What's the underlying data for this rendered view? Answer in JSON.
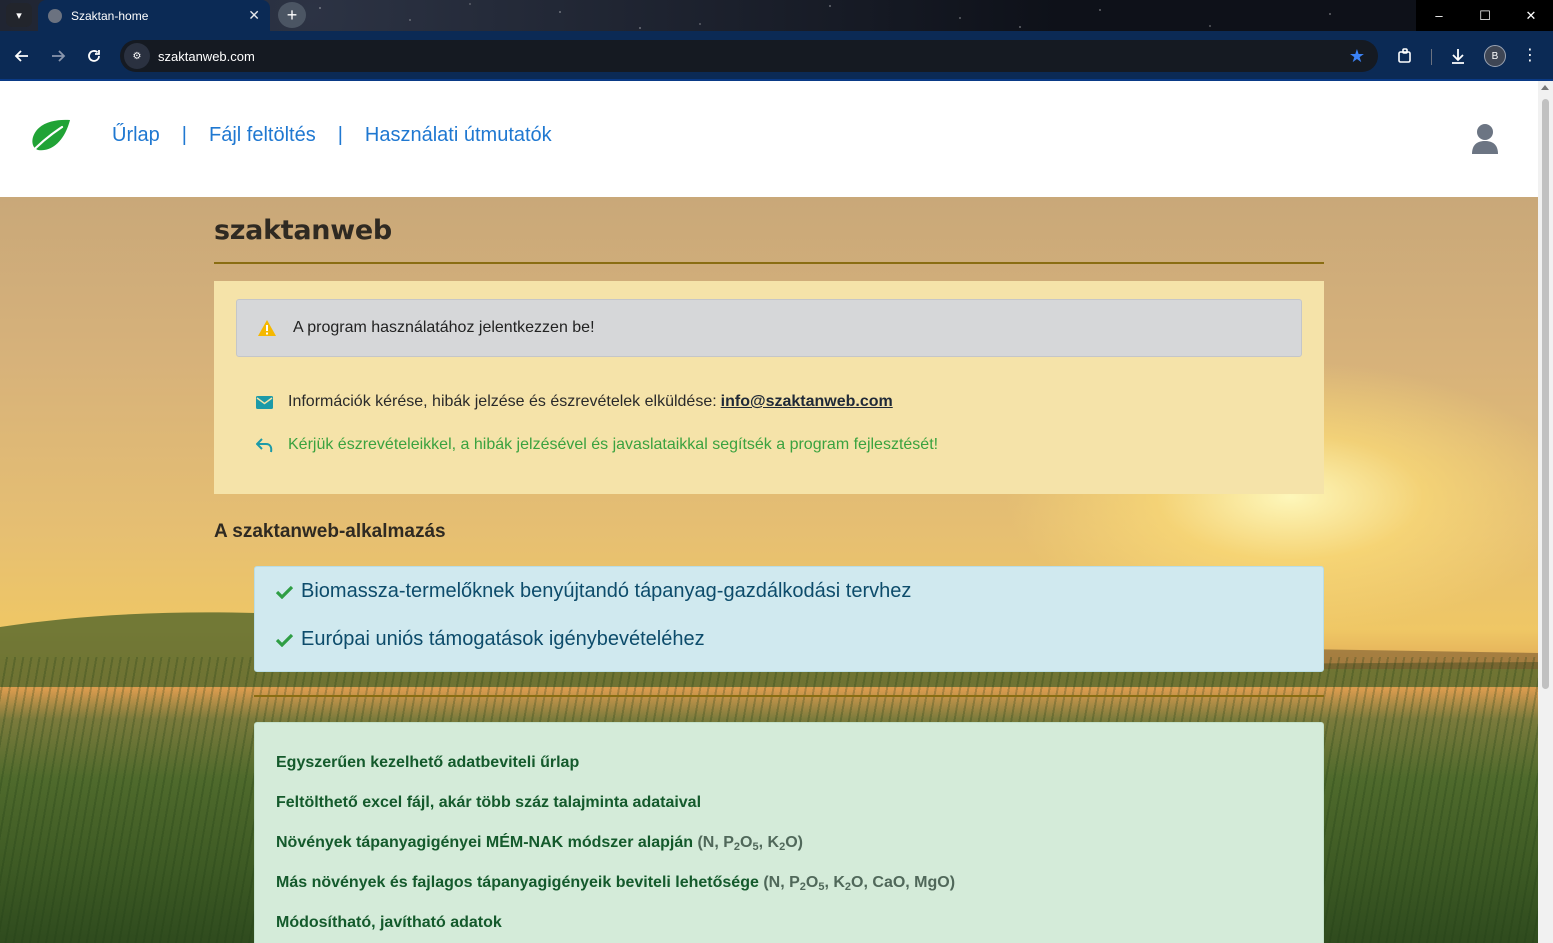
{
  "browser": {
    "tab_title": "Szaktan-home",
    "url": "szaktanweb.com",
    "profile_initial": "B",
    "tab_menu_icon": "chevron-down-icon",
    "new_tab_label": "+",
    "window_controls": {
      "minimize": "–",
      "maximize": "☐",
      "close": "✕"
    }
  },
  "header": {
    "nav": [
      {
        "label": "Űrlap"
      },
      {
        "label": "Fájl feltöltés"
      },
      {
        "label": "Használati útmutatók"
      }
    ],
    "separator": "|"
  },
  "main": {
    "title": "szaktanweb",
    "alert_text": "A program használatához jelentkezzen be!",
    "info_text": "Információk kérése, hibák jelzése és észrevételek elküldése:",
    "info_email": "info@szaktanweb.com",
    "feedback_text": "Kérjük észrevételeikkel, a hibák jelzésével és javaslataikkal segítsék a program fejlesztését!",
    "section_heading": "A szaktanweb-alkalmazás",
    "purposes": [
      "Biomassza-termelőknek benyújtandó tápanyag-gazdálkodási tervhez",
      "Európai uniós támogatások igénybevételéhez"
    ],
    "features": [
      {
        "text": "Egyszerűen kezelhető adatbeviteli űrlap"
      },
      {
        "text": "Feltölthető excel fájl, akár több száz talajminta adataival"
      },
      {
        "text": "Növények tápanyagigényei MÉM-NAK módszer alapján"
      },
      {
        "text": "Más növények és fajlagos tápanyagigényeik beviteli lehetősége"
      },
      {
        "text": "Módosítható, javítható adatok"
      }
    ],
    "nutrients_basic": {
      "open": "(N, P",
      "p_sub": "2",
      "o": "O",
      "o_sub": "5",
      "k": ", K",
      "k_sub": "2",
      "close": "O)"
    },
    "nutrients_extended": {
      "open": "(N, P",
      "p_sub": "2",
      "o": "O",
      "o_sub": "5",
      "k": ", K",
      "k_sub": "2",
      "close": "O, CaO, MgO)"
    }
  },
  "colors": {
    "nav_link": "#1f78d1",
    "accent_rule": "#8a6d12",
    "feedback_green": "#3aa23f",
    "check_green": "#2e9e44",
    "leaf_green": "#21a336"
  }
}
